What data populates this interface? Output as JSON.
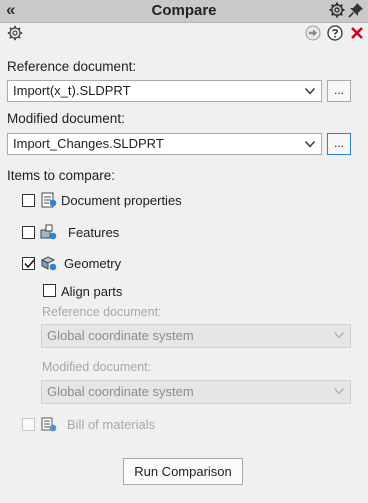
{
  "header": {
    "collapse_glyph": "«",
    "title": "Compare"
  },
  "reference": {
    "label": "Reference document:",
    "value": "Import(x_t).SLDPRT",
    "browse_label": "..."
  },
  "modified": {
    "label": "Modified document:",
    "value": "Import_Changes.SLDPRT",
    "browse_label": "..."
  },
  "items": {
    "label": "Items to compare:",
    "document_properties": {
      "label": "Document properties",
      "checked": false
    },
    "features": {
      "label": "Features",
      "checked": false
    },
    "geometry": {
      "label": "Geometry",
      "checked": true
    },
    "align_parts": {
      "label": "Align parts",
      "checked": false
    },
    "align_reference": {
      "label": "Reference document:",
      "value": "Global coordinate system"
    },
    "align_modified": {
      "label": "Modified document:",
      "value": "Global coordinate system"
    },
    "bill_of_materials": {
      "label": "Bill of materials",
      "checked": false
    }
  },
  "actions": {
    "run_label": "Run Comparison"
  },
  "colors": {
    "close": "#d0021b",
    "active_border": "#2f7fd4",
    "titlebar": "#c9c9c9"
  }
}
